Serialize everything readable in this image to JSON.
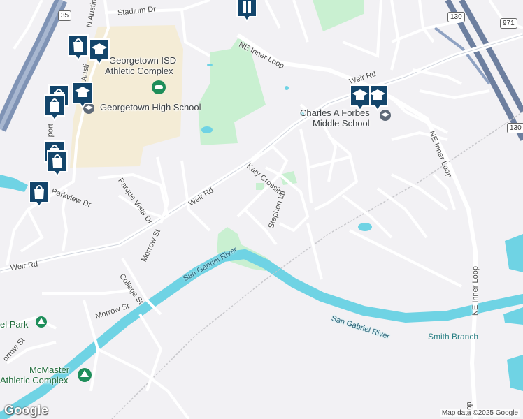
{
  "map": {
    "streets": {
      "stadium_dr": "Stadium Dr",
      "n_austin": "N Austin",
      "ne_inner_loop_top": "NE Inner Loop",
      "weir_rd_top": "Weir Rd",
      "weir_rd_mid": "Weir Rd",
      "weir_rd_left": "Weir Rd",
      "katy_crossing": "Katy Crossing",
      "stephen_ln": "Stephen Ln",
      "parque_vista_dr": "Parque Vista Dr",
      "parkview_dr": "Parkview Dr",
      "morrow_st_mid": "Morrow St",
      "morrow_st_low": "Morrow St",
      "morrow_st_left": "orrow St",
      "college_st": "College St",
      "ne_inner_loop_right": "NE Inner Loop",
      "ne_inner_loop_lower": "NE Inner Loop",
      "ne_inner_loop_bottom": "loop",
      "sport": "port",
      "austi_partial": "Austi"
    },
    "water": {
      "san_gabriel_river_upper": "San Gabriel River",
      "san_gabriel_river_lower": "San Gabriel River",
      "smith_branch": "Smith Branch"
    },
    "places": {
      "gisd_athletic_line1": "Georgetown ISD",
      "gisd_athletic_line2": "Athletic Complex",
      "georgetown_high": "Georgetown High School",
      "forbes_line1": "Charles A Forbes",
      "forbes_line2": "Middle School",
      "park_partial": "el Park",
      "mcmaster_line1": "McMaster",
      "mcmaster_line2": "Athletic Complex"
    },
    "shields": {
      "i35": "35",
      "sh130_top": "130",
      "sh130_right": "130",
      "fm971": "971"
    },
    "attribution": {
      "logo": "Google",
      "map_data": "Map data ©2025 Google"
    },
    "colors": {
      "background": "#f2f1f4",
      "park": "#c9f0d1",
      "school_area": "#f4ecd6",
      "water": "#6fd3e4",
      "highway": "#7f93b5",
      "marker": "#13456b"
    },
    "markers": [
      {
        "icon": "shopping-bag-icon"
      },
      {
        "icon": "graduation-cap-icon"
      },
      {
        "icon": "shopping-bag-icon"
      },
      {
        "icon": "graduation-cap-icon"
      },
      {
        "icon": "shopping-bag-icon"
      },
      {
        "icon": "shopping-bag-icon"
      },
      {
        "icon": "shopping-bag-icon"
      },
      {
        "icon": "shopping-bag-icon"
      },
      {
        "icon": "graduation-cap-icon"
      },
      {
        "icon": "graduation-cap-icon"
      },
      {
        "icon": "building-icon"
      }
    ]
  }
}
